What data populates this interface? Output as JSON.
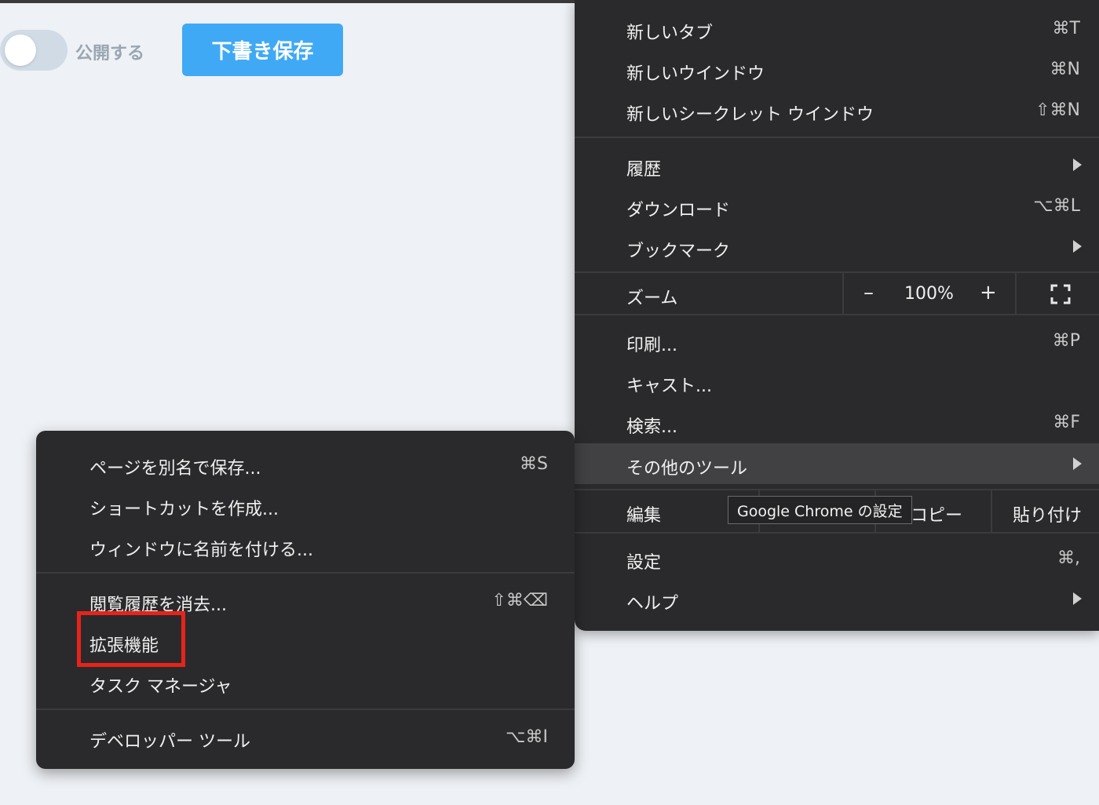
{
  "page": {
    "publish_toggle_label": "公開する",
    "save_draft_button": "下書き保存"
  },
  "main_menu": {
    "new_tab": {
      "label": "新しいタブ",
      "shortcut": "⌘T"
    },
    "new_window": {
      "label": "新しいウインドウ",
      "shortcut": "⌘N"
    },
    "new_incognito": {
      "label": "新しいシークレット ウインドウ",
      "shortcut": "⇧⌘N"
    },
    "history": {
      "label": "履歴"
    },
    "downloads": {
      "label": "ダウンロード",
      "shortcut": "⌥⌘L"
    },
    "bookmarks": {
      "label": "ブックマーク"
    },
    "zoom": {
      "label": "ズーム",
      "minus": "–",
      "value": "100%",
      "plus": "+"
    },
    "print": {
      "label": "印刷...",
      "shortcut": "⌘P"
    },
    "cast": {
      "label": "キャスト..."
    },
    "find": {
      "label": "検索...",
      "shortcut": "⌘F"
    },
    "more_tools": {
      "label": "その他のツール"
    },
    "edit": {
      "label": "編集",
      "copy": "コピー",
      "paste": "貼り付け"
    },
    "settings": {
      "label": "設定",
      "shortcut": "⌘,"
    },
    "help": {
      "label": "ヘルプ"
    }
  },
  "tooltip": "Google Chrome の設定",
  "sub_menu": {
    "save_page_as": {
      "label": "ページを別名で保存...",
      "shortcut": "⌘S"
    },
    "create_shortcut": {
      "label": "ショートカットを作成..."
    },
    "name_window": {
      "label": "ウィンドウに名前を付ける..."
    },
    "clear_browsing_data": {
      "label": "閲覧履歴を消去...",
      "shortcut": "⇧⌘⌫"
    },
    "extensions": {
      "label": "拡張機能"
    },
    "task_manager": {
      "label": "タスク マネージャ"
    },
    "developer_tools": {
      "label": "デベロッパー ツール",
      "shortcut": "⌥⌘I"
    }
  },
  "colors": {
    "menu_bg": "#2a2a2c",
    "highlight_bg": "#414144",
    "accent_button": "#3fa9f5",
    "annotation_box": "#e8231a"
  }
}
